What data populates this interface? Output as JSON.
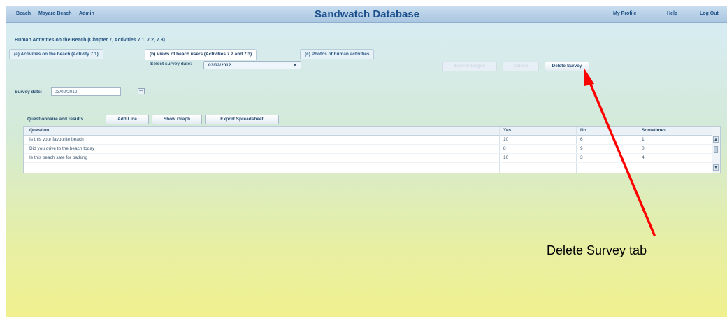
{
  "nav": {
    "left_links": [
      "Beach",
      "Mayaro Beach",
      "Admin"
    ],
    "title": "Sandwatch Database",
    "right_links": [
      "My Profile",
      "Help",
      "Log Out"
    ]
  },
  "section_heading": "Human Activities on the Beach (Chapter 7, Activities 7.1, 7.2, 7.3)",
  "tabs": [
    {
      "label": "(a) Activities on the beach (Activity 7.1)",
      "active": false
    },
    {
      "label": "(b) Views of beach users (Activities 7.2 and 7.3)",
      "active": true
    },
    {
      "label": "(c) Photos of human activities",
      "active": false
    }
  ],
  "survey_select": {
    "label": "Select survey date:",
    "value": "03/02/2012"
  },
  "action_buttons": [
    {
      "label": "Save Changes",
      "disabled": true
    },
    {
      "label": "Cancel",
      "disabled": true
    },
    {
      "label": "Delete Survey",
      "disabled": false
    }
  ],
  "survey_date": {
    "label": "Survey date:",
    "value": "03/02/2012"
  },
  "toolbar": {
    "label": "Questionnaire and results",
    "buttons": [
      "Add Line",
      "Show Graph",
      "Export Spreadsheet"
    ]
  },
  "table": {
    "columns": [
      "Question",
      "Yes",
      "No",
      "Sometimes"
    ],
    "rows": [
      [
        "Is this your favourite beach",
        "10",
        "6",
        "1"
      ],
      [
        "Did you drive to the beach today",
        "8",
        "9",
        "0"
      ],
      [
        "Is this beach safe for bathing",
        "10",
        "3",
        "4"
      ]
    ]
  },
  "annotation": {
    "text": "Delete Survey tab",
    "color": "#ff0000"
  }
}
